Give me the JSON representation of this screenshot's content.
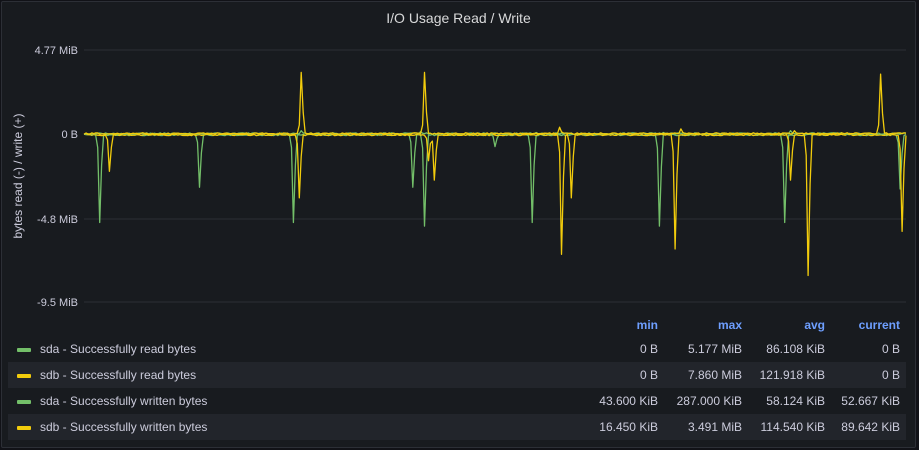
{
  "panel": {
    "title": "I/O Usage Read / Write"
  },
  "colors": {
    "green": "#73bf69",
    "yellow": "#f2cc0c",
    "grid": "#2c2f36",
    "text": "#ccccdc",
    "header": "#6e9fff"
  },
  "chart_data": {
    "type": "line",
    "title": "I/O Usage Read / Write",
    "ylabel": "bytes read (-) / write (+)",
    "y_ticks": [
      "4.77 MiB",
      "0 B",
      "-4.8 MiB",
      "-9.5 MiB"
    ],
    "y_tick_values": [
      4.77,
      0,
      -4.8,
      -9.5
    ],
    "ylim": [
      -9.5,
      4.77
    ],
    "grid": true,
    "legend_placement": "bottom",
    "series": [
      {
        "name": "sda - Successfully read bytes",
        "color": "#73bf69",
        "spikes": [
          [
            0.02,
            -5.0
          ],
          [
            0.255,
            -5.0
          ],
          [
            0.415,
            -5.2
          ],
          [
            0.545,
            -5.0
          ],
          [
            0.7,
            -5.2
          ],
          [
            0.853,
            -5.0
          ],
          [
            0.992,
            -3.1
          ],
          [
            0.14,
            -3.0
          ],
          [
            0.4,
            -3.0
          ],
          [
            0.5,
            -0.7
          ]
        ]
      },
      {
        "name": "sdb - Successfully read bytes",
        "color": "#f2cc0c",
        "spikes": [
          [
            0.032,
            -2.1
          ],
          [
            0.262,
            -3.6
          ],
          [
            0.425,
            -2.6
          ],
          [
            0.58,
            -6.8
          ],
          [
            0.718,
            -6.5
          ],
          [
            0.882,
            -8.0
          ],
          [
            0.995,
            -5.5
          ],
          [
            0.42,
            -1.5
          ],
          [
            0.592,
            -3.6
          ],
          [
            0.86,
            -2.6
          ]
        ]
      },
      {
        "name": "sda - Successfully written bytes",
        "color": "#73bf69",
        "spikes": [
          [
            0.265,
            0.2
          ],
          [
            0.41,
            0.15
          ],
          [
            0.55,
            0.1
          ],
          [
            0.705,
            0.1
          ],
          [
            0.86,
            0.2
          ]
        ]
      },
      {
        "name": "sdb - Successfully written bytes",
        "color": "#f2cc0c",
        "spikes": [
          [
            0.265,
            3.5
          ],
          [
            0.415,
            3.5
          ],
          [
            0.578,
            0.4
          ],
          [
            0.725,
            0.3
          ],
          [
            0.865,
            0.2
          ],
          [
            0.97,
            3.4
          ]
        ]
      }
    ]
  },
  "legend": {
    "headers": {
      "min": "min",
      "max": "max",
      "avg": "avg",
      "current": "current"
    },
    "rows": [
      {
        "name": "sda - Successfully read bytes",
        "color": "#73bf69",
        "min": "0 B",
        "max": "5.177 MiB",
        "avg": "86.108 KiB",
        "current": "0 B"
      },
      {
        "name": "sdb - Successfully read bytes",
        "color": "#f2cc0c",
        "min": "0 B",
        "max": "7.860 MiB",
        "avg": "121.918 KiB",
        "current": "0 B"
      },
      {
        "name": "sda - Successfully written bytes",
        "color": "#73bf69",
        "min": "43.600 KiB",
        "max": "287.000 KiB",
        "avg": "58.124 KiB",
        "current": "52.667 KiB"
      },
      {
        "name": "sdb - Successfully written bytes",
        "color": "#f2cc0c",
        "min": "16.450 KiB",
        "max": "3.491 MiB",
        "avg": "114.540 KiB",
        "current": "89.642 KiB"
      }
    ]
  }
}
